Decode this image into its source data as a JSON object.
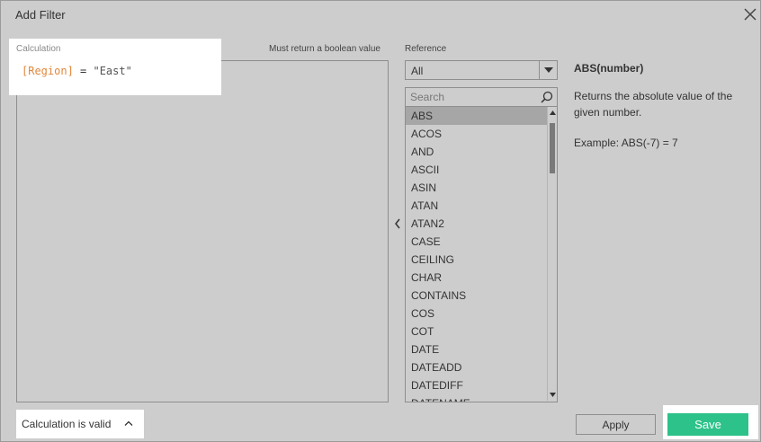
{
  "dialog": {
    "title": "Add Filter",
    "close_icon": "close-icon"
  },
  "calculation": {
    "label": "Calculation",
    "hint": "Must return a boolean value",
    "formula": {
      "field": "[Region]",
      "operator": " = ",
      "string": "\"East\""
    },
    "status": "Calculation is valid"
  },
  "reference": {
    "label": "Reference",
    "selected": "All",
    "search_placeholder": "Search",
    "functions": [
      "ABS",
      "ACOS",
      "AND",
      "ASCII",
      "ASIN",
      "ATAN",
      "ATAN2",
      "CASE",
      "CEILING",
      "CHAR",
      "CONTAINS",
      "COS",
      "COT",
      "DATE",
      "DATEADD",
      "DATEDIFF",
      "DATENAME"
    ],
    "selected_function": "ABS"
  },
  "help": {
    "title": "ABS(number)",
    "description": "Returns the absolute value of the given number.",
    "example": "Example: ABS(-7) = 7"
  },
  "buttons": {
    "apply": "Apply",
    "save": "Save"
  },
  "colors": {
    "field": "#e0883c",
    "save": "#2dc28a"
  }
}
